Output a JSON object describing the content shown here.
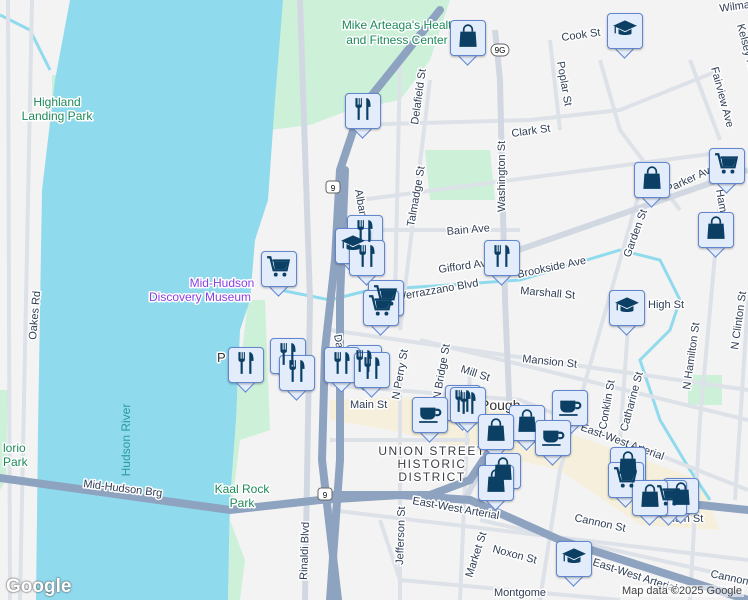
{
  "map": {
    "labels": {
      "mike_arteaga_1": "Mike Arteaga's Health",
      "mike_arteaga_2": "and Fitness Center",
      "highland_1": "Highland",
      "highland_2": "Landing Park",
      "museum_1": "Mid-Hudson",
      "museum_2": "Discovery Museum",
      "hudson_river": "Hudson River",
      "kaal_1": "Kaal Rock",
      "kaal_2": "Park",
      "florio_1": "lorio",
      "florio_2": "Park",
      "district_1": "UNION STREET",
      "district_2": "HISTORIC",
      "district_3": "DISTRICT",
      "pough": "Pough",
      "p_partial": "P"
    },
    "streets": {
      "cook": "Cook St",
      "wilma": "Wilma",
      "kelsey": "Kelsey Ro",
      "poplar": "Poplar St",
      "delafield": "Delafield St",
      "clark": "Clark St",
      "fairview": "Fairview Ave",
      "washington": "Washington St",
      "talmadge": "Talmadge St",
      "parker": "Parker Ave",
      "hamilton_partial": "Hamilton",
      "bain": "Bain Ave",
      "gifford": "Gifford Av",
      "brookside": "Brookside Ave",
      "garden": "Garden St",
      "verrazzano": "Verrazzano Blvd",
      "marshall": "Marshall St",
      "albany": "Albany St",
      "oakes": "Oakes Rd",
      "mansion": "Mansion St",
      "n_hamilton": "N Hamilton St",
      "n_clinton": "N Clinton St",
      "mill": "Mill St",
      "n_bridge": "N Bridge St",
      "n_perry": "N Perry St",
      "conklin": "Conklin St",
      "catharine": "Catharine St",
      "main": "Main St",
      "main2": "Main St",
      "high": "High St",
      "da": "Da",
      "mid_hudson_brg": "Mid-Hudson Brg",
      "east_west_1": "East-West Arterial",
      "east_west_2": "East-West Arterial",
      "east_west_3": "East-West Arterial",
      "cannon": "Cannon St",
      "cannon2": "Cannon",
      "noxon": "Noxon St",
      "market": "Market St",
      "jefferson": "Jefferson St",
      "rinaldi": "Rinaldi Blvd",
      "montgomery": "Montgome"
    },
    "shields": {
      "us9_a": "9",
      "us9_b": "9",
      "ny9g": "9G"
    },
    "markers": [
      "shopping-bag",
      "graduation-cap",
      "restaurant",
      "shopping-bag",
      "shopping-cart",
      "shopping-bag",
      "restaurant",
      "graduation-cap",
      "restaurant",
      "restaurant",
      "shopping-cart",
      "shopping-cart",
      "shopping-cart",
      "graduation-cap",
      "restaurant",
      "restaurant",
      "restaurant",
      "restaurant",
      "restaurant",
      "restaurant",
      "restaurant",
      "restaurant",
      "coffee-cup",
      "coffee-cup",
      "shopping-bag",
      "shopping-bag",
      "coffee-cup",
      "shopping-bag",
      "shopping-bag",
      "shopping-bag",
      "shopping-cart",
      "shopping-bag",
      "shopping-cart",
      "shopping-bag",
      "graduation-cap"
    ],
    "colors": {
      "water": "#8fdaed",
      "park": "#cdf0d9",
      "highway": "#8ea3c0",
      "marker_fill": "#e3ecfb",
      "marker_icon": "#0b3f64",
      "historic": "#f5efdc"
    }
  },
  "footer": {
    "google_logo": "Google",
    "attribution": "Map data ©2025 Google"
  }
}
